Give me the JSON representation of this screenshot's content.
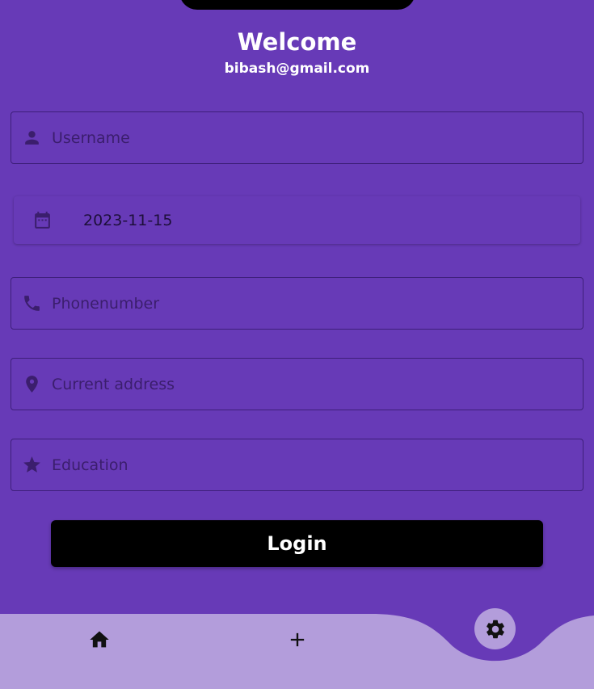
{
  "header": {
    "title": "Welcome",
    "email": "bibash@gmail.com"
  },
  "form": {
    "username": {
      "placeholder": "Username",
      "icon": "person-icon"
    },
    "date": {
      "value": "2023-11-15",
      "icon": "calendar-icon"
    },
    "phone": {
      "placeholder": "Phonenumber",
      "icon": "phone-icon"
    },
    "address": {
      "placeholder": "Current address",
      "icon": "location-pin-icon"
    },
    "education": {
      "placeholder": "Education",
      "icon": "star-icon"
    }
  },
  "login_label": "Login",
  "bottom_nav": {
    "items": [
      {
        "icon": "home-icon"
      },
      {
        "icon": "add-icon"
      },
      {
        "icon": "gear-icon"
      }
    ]
  },
  "colors": {
    "background": "#673ab7",
    "navbar": "#b39ddb",
    "button": "#000000",
    "icon": "#3b1e6d"
  }
}
